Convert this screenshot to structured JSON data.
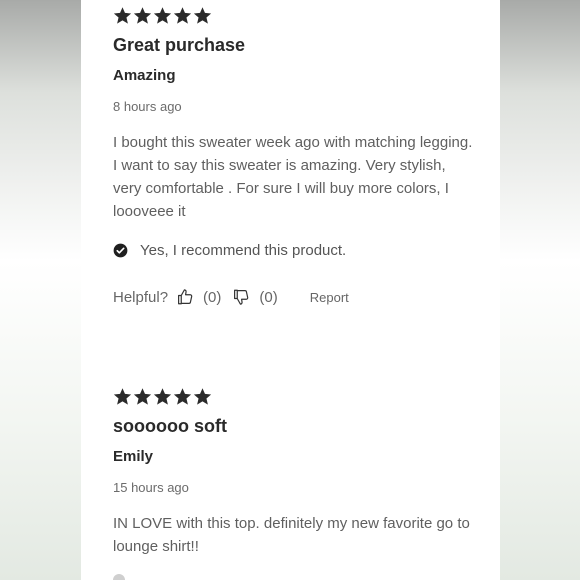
{
  "reviews": [
    {
      "rating": 5,
      "title": "Great purchase",
      "author": "Amazing",
      "time": "8 hours ago",
      "body": "I bought this sweater week ago with matching legging. I want to say this sweater is amazing. Very stylish, very comfortable . For sure I will buy more colors, I loooveee it",
      "recommend": "Yes, I recommend this product.",
      "helpful_label": "Helpful?",
      "helpful_up": "(0)",
      "helpful_down": "(0)",
      "report": "Report"
    },
    {
      "rating": 5,
      "title": "soooooo soft",
      "author": "Emily",
      "time": "15 hours ago",
      "body": "IN LOVE with this top. definitely my new favorite go to lounge shirt!!"
    }
  ],
  "icons": {
    "star": "star-icon",
    "check": "check-circle-icon",
    "thumb_up": "thumbs-up-icon",
    "thumb_down": "thumbs-down-icon"
  },
  "colors": {
    "star": "#2b2b2b",
    "text_dark": "#2a2a2a",
    "text_muted": "#6b6b6b"
  }
}
